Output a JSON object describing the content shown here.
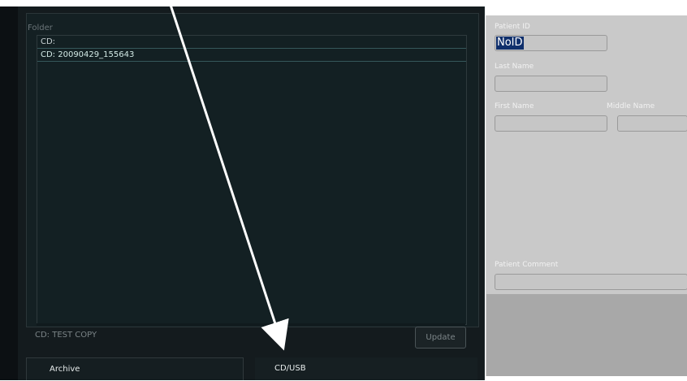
{
  "folder": {
    "label": "Folder",
    "items": [
      "CD:",
      "CD: 20090429_155643"
    ]
  },
  "status": {
    "text": "CD: TEST COPY"
  },
  "buttons": {
    "update": "Update"
  },
  "tabs": {
    "archive": "Archive",
    "cd_usb": "CD/USB"
  },
  "patient": {
    "id_label": "Patient ID",
    "id_value": "NoID",
    "last_name_label": "Last Name",
    "first_name_label": "First Name",
    "middle_name_label": "Middle Name",
    "comment_label": "Patient Comment"
  },
  "colors": {
    "panel_dark": "#141b1e",
    "list_bg": "#132023",
    "selection_blue": "#0f2f6c",
    "right_panel": "#c9c9c9"
  }
}
